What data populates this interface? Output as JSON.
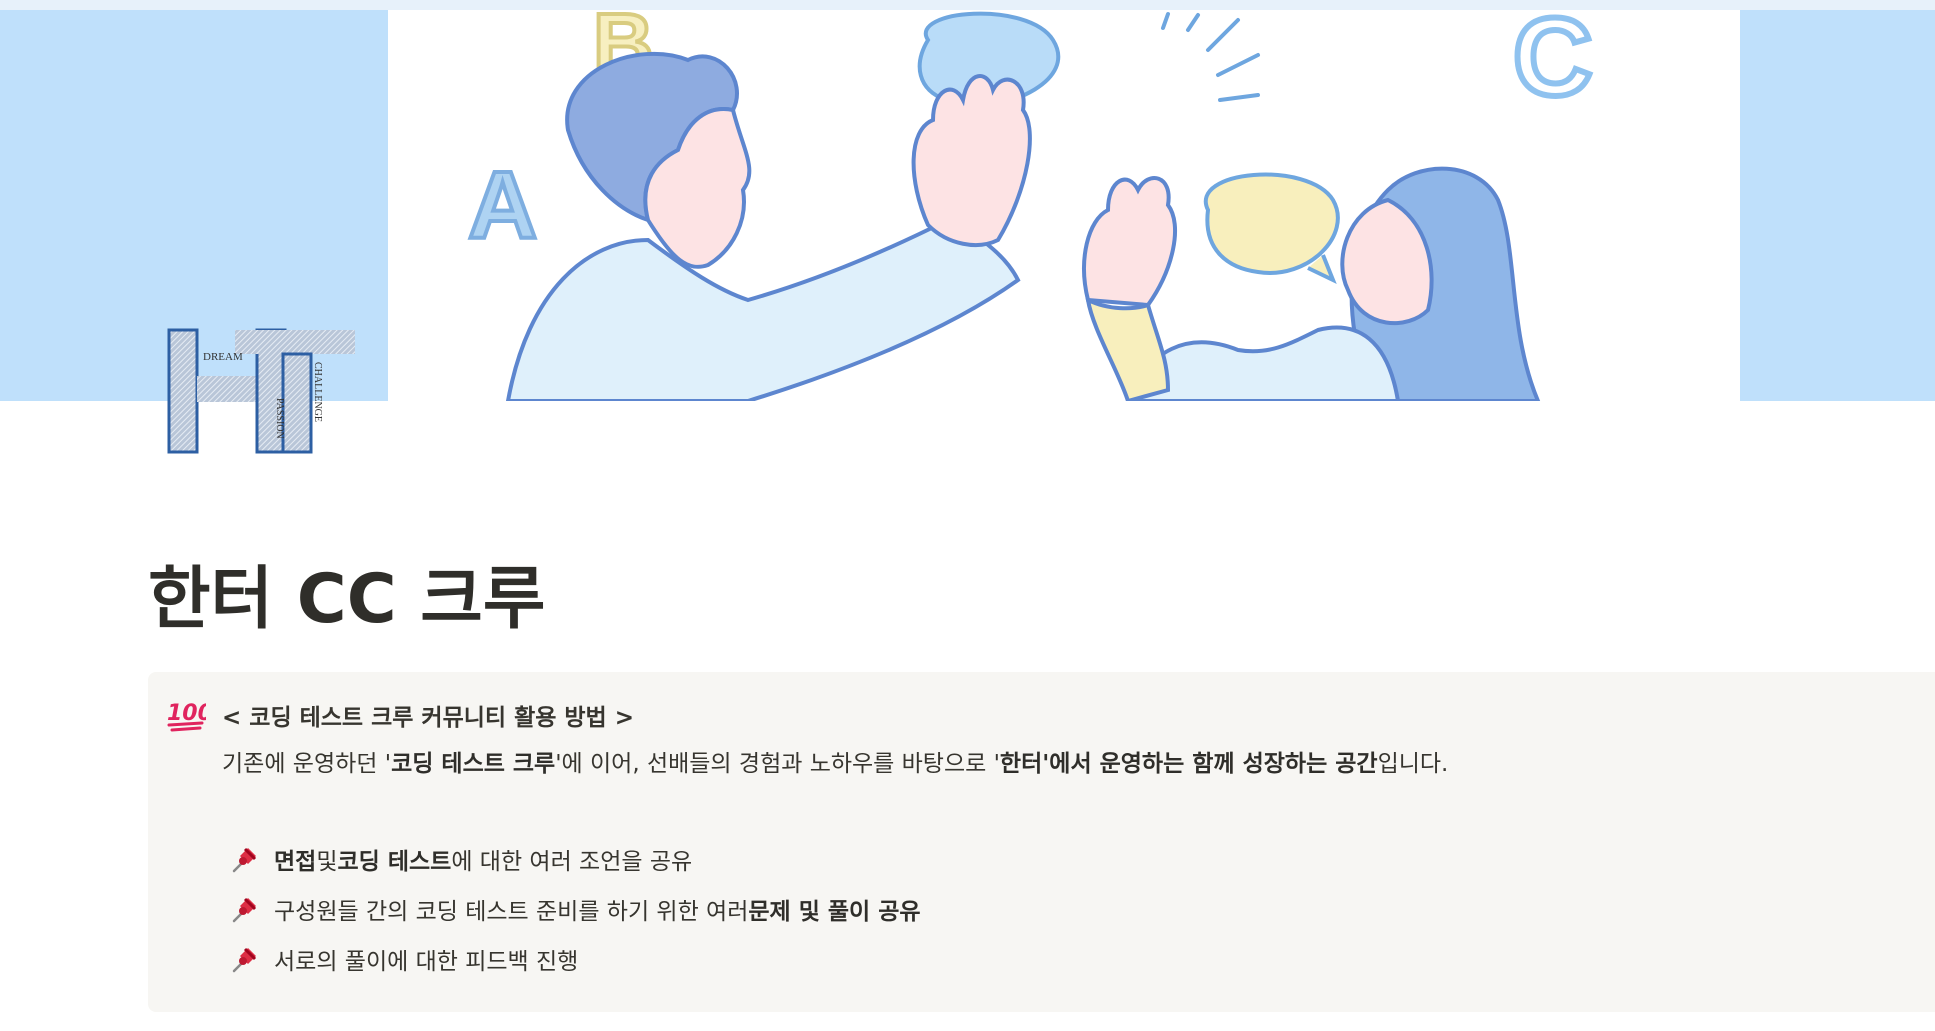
{
  "page": {
    "title": "한터 CC 크루",
    "icon": "ht-logo-icon",
    "icon_words": [
      "DREAM",
      "PASSION",
      "CHALLENGE"
    ]
  },
  "cover": {
    "letters": [
      "A",
      "B",
      "C"
    ],
    "background": "#bfe0fb"
  },
  "callout": {
    "emoji": "hundred-points-icon",
    "heading": "< 코딩 테스트 크루 커뮤니티 활용 방법 >",
    "body": {
      "t1": "기존에 운영하던 '",
      "b1": "코딩 테스트 크루",
      "t2": "'에 이어, 선배들의 경험과 노하우를 바탕으로 '",
      "b2": "한터'에서 운영하는 함께 성장하는 공간",
      "t3": "입니다."
    },
    "bullets": [
      {
        "icon": "pushpin-icon",
        "b1": "면접",
        "t1": " 및 ",
        "b2": "코딩 테스트",
        "t2": "에 대한 여러 조언을 공유"
      },
      {
        "icon": "pushpin-icon",
        "t1": "구성원들 간의 코딩 테스트 준비를 하기 위한 여러 ",
        "b1": "문제 및 풀이 공유"
      },
      {
        "icon": "pushpin-icon",
        "t1": "서로의 풀이에 대한 피드백 진행"
      }
    ]
  },
  "colors": {
    "cover_blue": "#bfe0fb",
    "callout_bg": "#f7f6f3",
    "text": "#37352f",
    "emoji_red": "#e0245e"
  }
}
